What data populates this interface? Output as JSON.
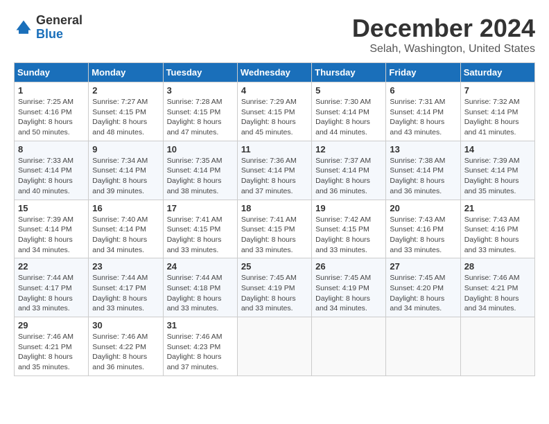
{
  "logo": {
    "general": "General",
    "blue": "Blue"
  },
  "title": "December 2024",
  "subtitle": "Selah, Washington, United States",
  "weekdays": [
    "Sunday",
    "Monday",
    "Tuesday",
    "Wednesday",
    "Thursday",
    "Friday",
    "Saturday"
  ],
  "weeks": [
    [
      {
        "day": "1",
        "sunrise": "7:25 AM",
        "sunset": "4:16 PM",
        "daylight": "8 hours and 50 minutes."
      },
      {
        "day": "2",
        "sunrise": "7:27 AM",
        "sunset": "4:15 PM",
        "daylight": "8 hours and 48 minutes."
      },
      {
        "day": "3",
        "sunrise": "7:28 AM",
        "sunset": "4:15 PM",
        "daylight": "8 hours and 47 minutes."
      },
      {
        "day": "4",
        "sunrise": "7:29 AM",
        "sunset": "4:15 PM",
        "daylight": "8 hours and 45 minutes."
      },
      {
        "day": "5",
        "sunrise": "7:30 AM",
        "sunset": "4:14 PM",
        "daylight": "8 hours and 44 minutes."
      },
      {
        "day": "6",
        "sunrise": "7:31 AM",
        "sunset": "4:14 PM",
        "daylight": "8 hours and 43 minutes."
      },
      {
        "day": "7",
        "sunrise": "7:32 AM",
        "sunset": "4:14 PM",
        "daylight": "8 hours and 41 minutes."
      }
    ],
    [
      {
        "day": "8",
        "sunrise": "7:33 AM",
        "sunset": "4:14 PM",
        "daylight": "8 hours and 40 minutes."
      },
      {
        "day": "9",
        "sunrise": "7:34 AM",
        "sunset": "4:14 PM",
        "daylight": "8 hours and 39 minutes."
      },
      {
        "day": "10",
        "sunrise": "7:35 AM",
        "sunset": "4:14 PM",
        "daylight": "8 hours and 38 minutes."
      },
      {
        "day": "11",
        "sunrise": "7:36 AM",
        "sunset": "4:14 PM",
        "daylight": "8 hours and 37 minutes."
      },
      {
        "day": "12",
        "sunrise": "7:37 AM",
        "sunset": "4:14 PM",
        "daylight": "8 hours and 36 minutes."
      },
      {
        "day": "13",
        "sunrise": "7:38 AM",
        "sunset": "4:14 PM",
        "daylight": "8 hours and 36 minutes."
      },
      {
        "day": "14",
        "sunrise": "7:39 AM",
        "sunset": "4:14 PM",
        "daylight": "8 hours and 35 minutes."
      }
    ],
    [
      {
        "day": "15",
        "sunrise": "7:39 AM",
        "sunset": "4:14 PM",
        "daylight": "8 hours and 34 minutes."
      },
      {
        "day": "16",
        "sunrise": "7:40 AM",
        "sunset": "4:14 PM",
        "daylight": "8 hours and 34 minutes."
      },
      {
        "day": "17",
        "sunrise": "7:41 AM",
        "sunset": "4:15 PM",
        "daylight": "8 hours and 33 minutes."
      },
      {
        "day": "18",
        "sunrise": "7:41 AM",
        "sunset": "4:15 PM",
        "daylight": "8 hours and 33 minutes."
      },
      {
        "day": "19",
        "sunrise": "7:42 AM",
        "sunset": "4:15 PM",
        "daylight": "8 hours and 33 minutes."
      },
      {
        "day": "20",
        "sunrise": "7:43 AM",
        "sunset": "4:16 PM",
        "daylight": "8 hours and 33 minutes."
      },
      {
        "day": "21",
        "sunrise": "7:43 AM",
        "sunset": "4:16 PM",
        "daylight": "8 hours and 33 minutes."
      }
    ],
    [
      {
        "day": "22",
        "sunrise": "7:44 AM",
        "sunset": "4:17 PM",
        "daylight": "8 hours and 33 minutes."
      },
      {
        "day": "23",
        "sunrise": "7:44 AM",
        "sunset": "4:17 PM",
        "daylight": "8 hours and 33 minutes."
      },
      {
        "day": "24",
        "sunrise": "7:44 AM",
        "sunset": "4:18 PM",
        "daylight": "8 hours and 33 minutes."
      },
      {
        "day": "25",
        "sunrise": "7:45 AM",
        "sunset": "4:19 PM",
        "daylight": "8 hours and 33 minutes."
      },
      {
        "day": "26",
        "sunrise": "7:45 AM",
        "sunset": "4:19 PM",
        "daylight": "8 hours and 34 minutes."
      },
      {
        "day": "27",
        "sunrise": "7:45 AM",
        "sunset": "4:20 PM",
        "daylight": "8 hours and 34 minutes."
      },
      {
        "day": "28",
        "sunrise": "7:46 AM",
        "sunset": "4:21 PM",
        "daylight": "8 hours and 34 minutes."
      }
    ],
    [
      {
        "day": "29",
        "sunrise": "7:46 AM",
        "sunset": "4:21 PM",
        "daylight": "8 hours and 35 minutes."
      },
      {
        "day": "30",
        "sunrise": "7:46 AM",
        "sunset": "4:22 PM",
        "daylight": "8 hours and 36 minutes."
      },
      {
        "day": "31",
        "sunrise": "7:46 AM",
        "sunset": "4:23 PM",
        "daylight": "8 hours and 37 minutes."
      },
      null,
      null,
      null,
      null
    ]
  ]
}
